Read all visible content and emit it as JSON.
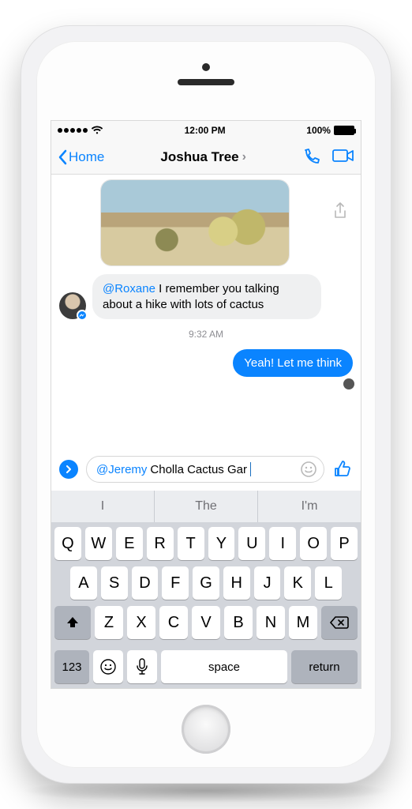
{
  "status": {
    "time": "12:00 PM",
    "battery_pct": "100%"
  },
  "nav": {
    "back_label": "Home",
    "title": "Joshua Tree"
  },
  "chat": {
    "incoming": {
      "mention": "@Roxane",
      "text": " I remember you talking about a hike with lots of cactus"
    },
    "timestamp": "9:32 AM",
    "outgoing": {
      "text": "Yeah! Let me think"
    }
  },
  "composer": {
    "mention": "@Jeremy",
    "text": " Cholla Cactus Gar"
  },
  "keyboard": {
    "suggestions": [
      "I",
      "The",
      "I'm"
    ],
    "row1": [
      "Q",
      "W",
      "E",
      "R",
      "T",
      "Y",
      "U",
      "I",
      "O",
      "P"
    ],
    "row2": [
      "A",
      "S",
      "D",
      "F",
      "G",
      "H",
      "J",
      "K",
      "L"
    ],
    "row3": [
      "Z",
      "X",
      "C",
      "V",
      "B",
      "N",
      "M"
    ],
    "numkey": "123",
    "space": "space",
    "return": "return"
  }
}
